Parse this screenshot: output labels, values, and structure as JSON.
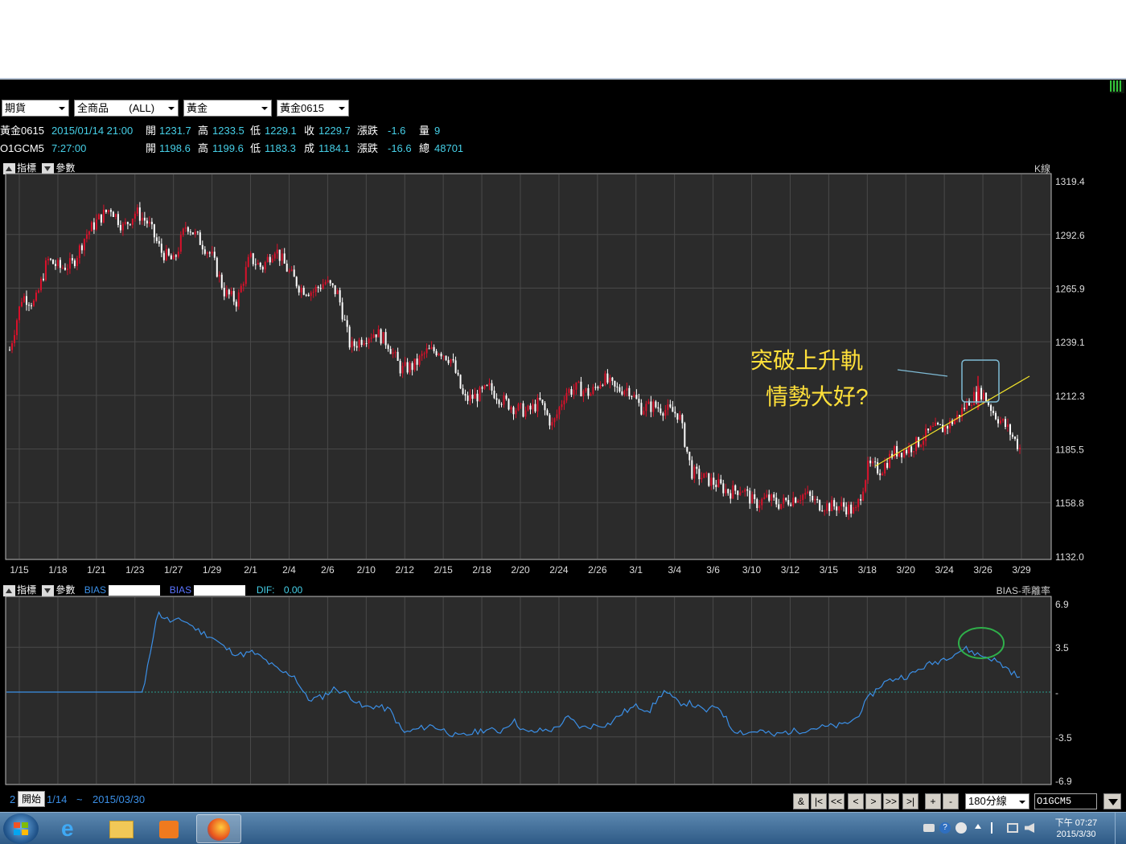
{
  "dropdowns": [
    {
      "value": "期貨"
    },
    {
      "value": "全商品       (ALL)"
    },
    {
      "value": "黃金"
    },
    {
      "value": "黃金0615"
    }
  ],
  "quote1": {
    "symbol": "黃金0615",
    "datetime": "2015/01/14 21:00",
    "open_label": "開",
    "open": "1231.7",
    "high_label": "高",
    "high": "1233.5",
    "low_label": "低",
    "low": "1229.1",
    "close_label": "收",
    "close": "1229.7",
    "change_label": "漲跌",
    "change": "-1.6",
    "vol_label": "量",
    "vol": "9"
  },
  "quote2": {
    "symbol": "O1GCM5",
    "time": "7:27:00",
    "open_label": "開",
    "open": "1198.6",
    "high_label": "高",
    "high": "1199.6",
    "low_label": "低",
    "low": "1183.3",
    "close_label": "成",
    "close": "1184.1",
    "change_label": "漲跌",
    "change": "-16.6",
    "vol_label": "總",
    "vol": "48701"
  },
  "main_toolbar": {
    "indicator": "指標",
    "param": "參數",
    "right_label": "K線"
  },
  "sub_toolbar": {
    "indicator": "指標",
    "param": "參數",
    "bias1": "BIAS",
    "bias2": "BIAS",
    "dif_label": "DIF:",
    "dif_value": "0.00",
    "right_label": "BIAS-乖離率"
  },
  "annotation": {
    "line1": "突破上升軌",
    "line2": "情勢大好?"
  },
  "price_axis": [
    "1319.4",
    "1292.6",
    "1265.9",
    "1239.1",
    "1212.3",
    "1185.5",
    "1158.8",
    "1132.0"
  ],
  "bias_axis": [
    "6.9",
    "3.5",
    "-",
    "-3.5",
    "-6.9"
  ],
  "date_labels": [
    "1/15",
    "1/18",
    "1/21",
    "1/23",
    "1/27",
    "1/29",
    "2/1",
    "2/4",
    "2/6",
    "2/10",
    "2/12",
    "2/15",
    "2/18",
    "2/20",
    "2/24",
    "2/26",
    "3/1",
    "3/4",
    "3/6",
    "3/10",
    "3/12",
    "3/15",
    "3/18",
    "3/20",
    "3/24",
    "3/26",
    "3/29"
  ],
  "chart_data": [
    {
      "type": "candlestick",
      "x_labels": [
        "1/15",
        "1/18",
        "1/21",
        "1/23",
        "1/27",
        "1/29",
        "2/1",
        "2/4",
        "2/6",
        "2/10",
        "2/12",
        "2/15",
        "2/18",
        "2/20",
        "2/24",
        "2/26",
        "3/1",
        "3/4",
        "3/6",
        "3/10",
        "3/12",
        "3/15",
        "3/18",
        "3/20",
        "3/24",
        "3/26",
        "3/29"
      ],
      "close_path": [
        1235,
        1262,
        1258,
        1280,
        1276,
        1278,
        1292,
        1300,
        1306,
        1296,
        1304,
        1298,
        1284,
        1279,
        1298,
        1290,
        1282,
        1264,
        1259,
        1281,
        1276,
        1286,
        1275,
        1266,
        1264,
        1269,
        1263,
        1236,
        1241,
        1244,
        1238,
        1225,
        1227,
        1234,
        1235,
        1230,
        1210,
        1212,
        1216,
        1210,
        1206,
        1204,
        1209,
        1197,
        1214,
        1216,
        1213,
        1221,
        1215,
        1216,
        1206,
        1207,
        1205,
        1203,
        1174,
        1171,
        1168,
        1164,
        1166,
        1158,
        1161,
        1158,
        1161,
        1163,
        1158,
        1157,
        1157,
        1154,
        1177,
        1175,
        1184,
        1185,
        1189,
        1195,
        1196,
        1201,
        1210,
        1214,
        1203,
        1196,
        1186
      ],
      "ylim": [
        1132.0,
        1319.4
      ]
    },
    {
      "type": "line",
      "name": "BIAS",
      "values": [
        0,
        0,
        0,
        0,
        0,
        0,
        0,
        0,
        0,
        0,
        0,
        6.2,
        5.5,
        5.6,
        4.8,
        4.3,
        3.4,
        2.9,
        3.1,
        2.4,
        1.6,
        1.3,
        -0.6,
        -0.4,
        0.3,
        -0.2,
        -1.2,
        -1.1,
        -1.4,
        -3.2,
        -2.9,
        -2.6,
        -3.0,
        -3.5,
        -3.2,
        -2.9,
        -3.1,
        -2.2,
        -3.2,
        -3.0,
        -2.9,
        -2.0,
        -2.8,
        -2.6,
        -2.5,
        -1.6,
        -1.1,
        -1.4,
        0.1,
        -0.8,
        -0.9,
        -1.5,
        -1.1,
        -2.9,
        -3.2,
        -3.0,
        -3.4,
        -3.1,
        -3.0,
        -2.8,
        -2.7,
        -2.6,
        -2.1,
        -0.4,
        0.7,
        1.1,
        1.3,
        2.0,
        2.4,
        2.9,
        3.4,
        2.9,
        2.6,
        1.9,
        1.1
      ],
      "ylim": [
        -6.9,
        6.9
      ]
    }
  ],
  "bottom_bar": {
    "start_button": "開始",
    "range_prefix": "2",
    "range_start": "1/14",
    "range_sep": "~",
    "range_end": "2015/03/30",
    "nav_buttons": [
      "&",
      "|<",
      "<<",
      "<",
      ">",
      ">>",
      ">|",
      "+",
      "-"
    ],
    "period_select": "180分線",
    "symbol_input": "O1GCM5"
  },
  "taskbar": {
    "time": "下午 07:27",
    "date": "2015/3/30"
  },
  "colors": {
    "up": "#d9112b",
    "down": "#ffffff",
    "bias_line": "#3b8fe6",
    "axis_text": "#dddddd",
    "annotation": "#ffe03a",
    "trendline": "#f0e22a",
    "highlight_box": "#7fbcd6",
    "highlight_circle": "#2fb04a"
  }
}
